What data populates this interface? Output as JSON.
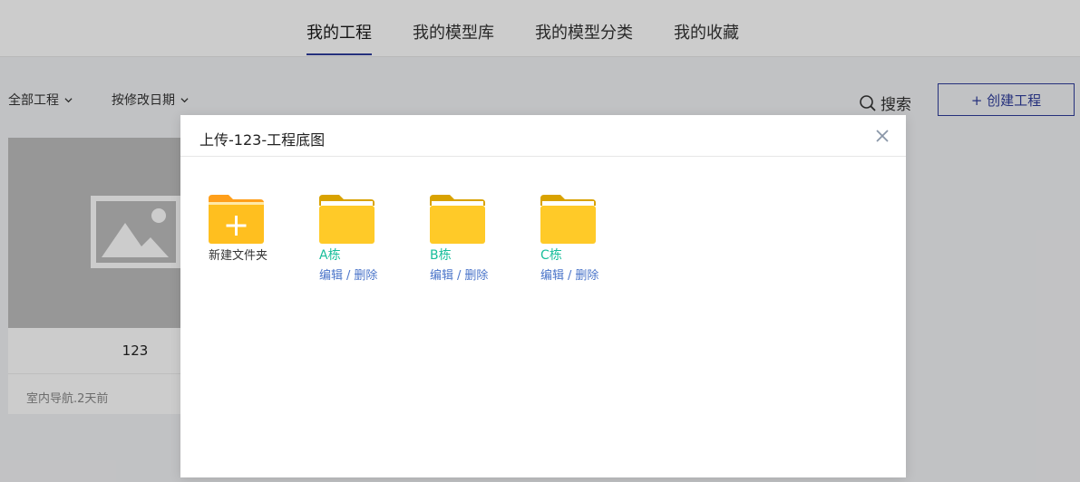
{
  "nav": {
    "tabs": [
      {
        "label": "我的工程",
        "active": true
      },
      {
        "label": "我的模型库",
        "active": false
      },
      {
        "label": "我的模型分类",
        "active": false
      },
      {
        "label": "我的收藏",
        "active": false
      }
    ]
  },
  "toolbar": {
    "filter_all": "全部工程",
    "sort_by": "按修改日期",
    "search_label": "搜索",
    "create_label": "+ 创建工程"
  },
  "project_card": {
    "name": "123",
    "meta": "室内导航.2天前"
  },
  "modal": {
    "title": "上传-123-工程底图",
    "new_folder_label": "新建文件夹",
    "folders": [
      {
        "name": "A栋",
        "edit": "编辑",
        "delete": "删除"
      },
      {
        "name": "B栋",
        "edit": "编辑",
        "delete": "删除"
      },
      {
        "name": "C栋",
        "edit": "编辑",
        "delete": "删除"
      }
    ],
    "action_separator": "/"
  },
  "colors": {
    "accent": "#2f3d9c",
    "folder_yellow": "#ffca28",
    "folder_tab": "#e5a800",
    "folder_name": "#19be9b",
    "action_link": "#4a74c9"
  }
}
